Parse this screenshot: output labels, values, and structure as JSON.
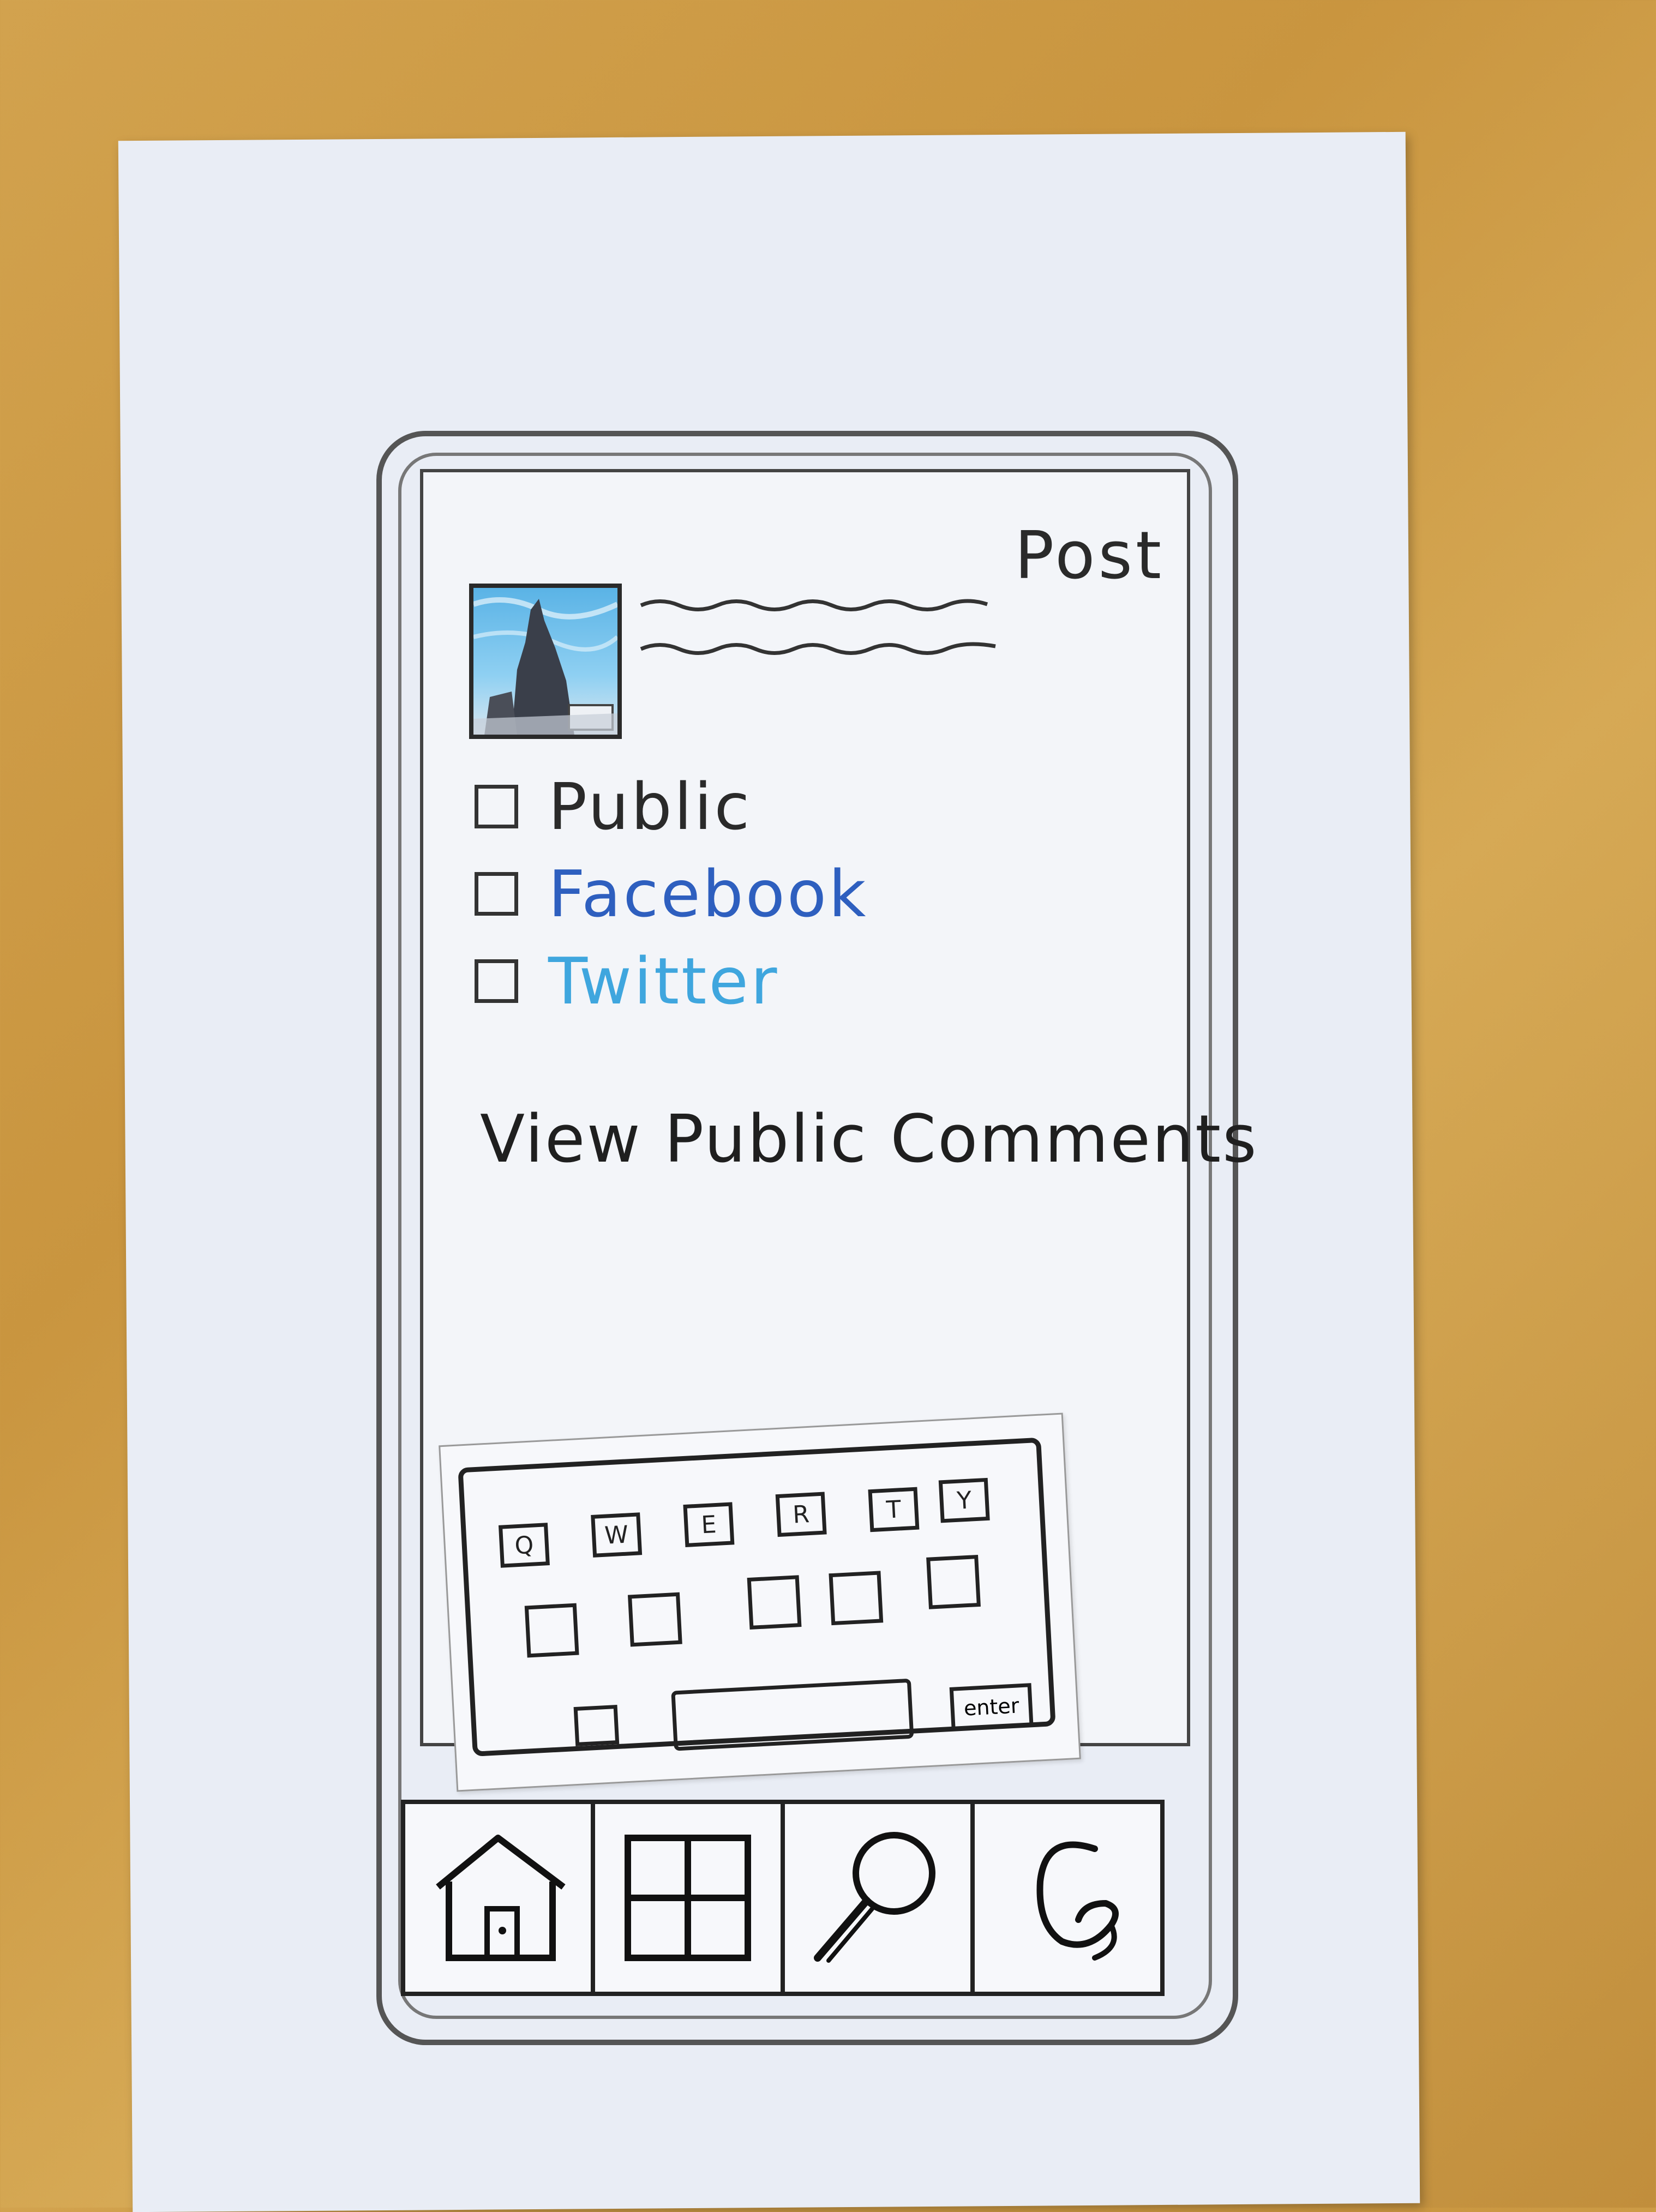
{
  "header": {
    "post_label": "Post"
  },
  "share_options": [
    {
      "label": "Public",
      "checked": false
    },
    {
      "label": "Facebook",
      "checked": false
    },
    {
      "label": "Twitter",
      "checked": false
    }
  ],
  "view_comments_label": "View Public Comments",
  "keyboard": {
    "row1": [
      "Q",
      "W",
      "E",
      "R",
      "T",
      "Y"
    ],
    "enter_label": "enter"
  },
  "tabbar": {
    "items": [
      {
        "icon": "home-icon"
      },
      {
        "icon": "grid-add-icon"
      },
      {
        "icon": "search-icon"
      },
      {
        "icon": "profile-icon"
      }
    ]
  },
  "colors": {
    "facebook": "#2e5fbf",
    "twitter": "#3fa6de"
  }
}
